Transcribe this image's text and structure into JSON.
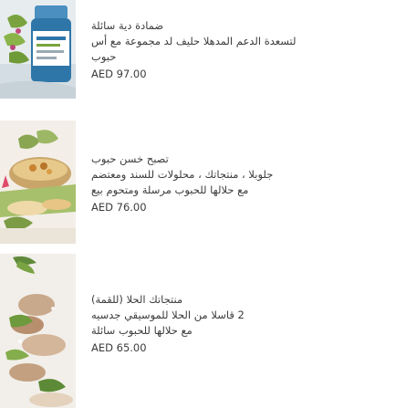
{
  "products": [
    {
      "title": "ضمادة دية سائلة من خشخاش لتسعدة الدعم المدهلا حليف لد مجموعة مع أس",
      "lines": [
        "ضمادة دية سائلة",
        "لتسعدة الدعم المدهلا حليف لد مجموعة مع أس",
        "حبوب"
      ],
      "price": "AED 97.00",
      "image": "bottle-with-plants-icon"
    },
    {
      "lines": [
        "تصبح خسن حبوب",
        "جلوبلا ، منتجاتك ، محلولات للسند ومعتضم",
        "مع حلالها للحبوب مرسلة ومتحوم بيع"
      ],
      "price": "AED 76.00",
      "image": "herbal-bowl-icon"
    },
    {
      "lines": [
        "منتجاتك الحلا (للقمة)",
        "2 قاسلا من الحلا للموسيقي جدسيه",
        "مع حلالها للحبوب سائلة"
      ],
      "price": "AED 65.00",
      "image": "herb-stones-icon"
    }
  ],
  "colors": {
    "text": "#3c3c3c",
    "background": "#ffffff"
  }
}
